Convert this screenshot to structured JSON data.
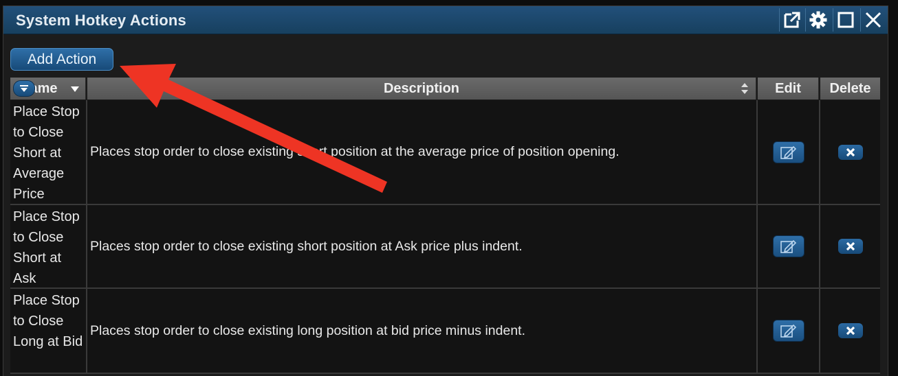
{
  "window": {
    "title": "System Hotkey Actions",
    "controls": [
      "popout-icon",
      "gear-icon",
      "maximize-icon",
      "close-icon"
    ]
  },
  "toolbar": {
    "add_label": "Add Action"
  },
  "table": {
    "columns": {
      "name": "Name",
      "description": "Description",
      "edit": "Edit",
      "delete": "Delete"
    },
    "rows": [
      {
        "name": "Place Stop to Close Short at Average Price",
        "description": "Places stop order to close existing short position at the average price of position opening."
      },
      {
        "name": "Place Stop to Close Short at Ask",
        "description": "Places stop order to close existing short position at Ask price plus indent."
      },
      {
        "name": "Place Stop to Close Long at Bid",
        "description": "Places stop order to close existing long position at bid price minus indent."
      }
    ]
  },
  "colors": {
    "titlebar": "#1d4a6f",
    "accent": "#2f6fa8",
    "annotation_arrow": "#ee3424"
  }
}
